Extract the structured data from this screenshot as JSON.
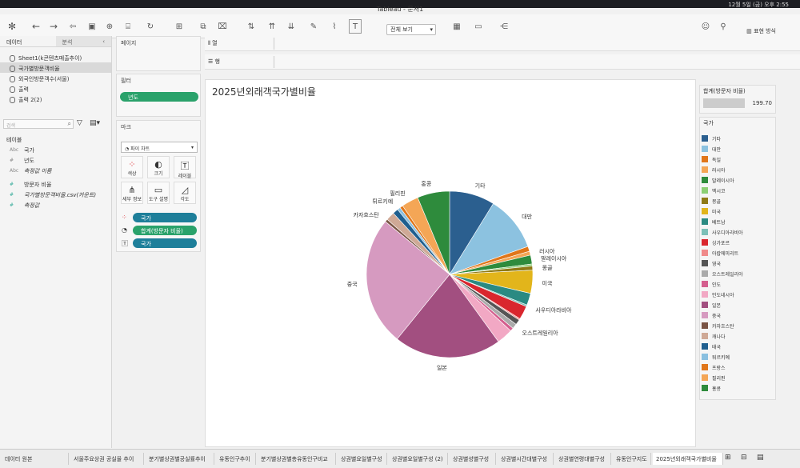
{
  "menubar": {
    "datetime": "12월 5일 (금) 오후 2:55"
  },
  "window": {
    "title": "Tableau - 문서1"
  },
  "toolbar": {
    "view_mode": "전체 보기",
    "show_me": "표현 방식"
  },
  "data_pane": {
    "tabs": [
      "데이터",
      "분석"
    ],
    "datasources": [
      "Sheet1(k콘텐츠매출추이)",
      "국가별방문객비율",
      "외국인방문객수(서울)",
      "출력",
      "출력 2(2)"
    ],
    "search_placeholder": "검색",
    "tables_header": "테이블",
    "fields": [
      {
        "type": "Abc",
        "name": "국가",
        "italic": false
      },
      {
        "type": "#",
        "name": "년도",
        "italic": false
      },
      {
        "type": "Abc",
        "name": "측정값 이름",
        "italic": true
      },
      {
        "type": "#",
        "name": "방문자 비율",
        "italic": false
      },
      {
        "type": "#",
        "name": "국가별방문객비율.csv(카운트)",
        "italic": true
      },
      {
        "type": "#",
        "name": "측정값",
        "italic": true
      }
    ]
  },
  "pages": {
    "title": "페이지"
  },
  "filters": {
    "title": "필터",
    "pills": [
      "년도"
    ]
  },
  "marks": {
    "title": "마크",
    "type": "파이 차트",
    "buttons": [
      {
        "label": "색상",
        "icon": "color-icon"
      },
      {
        "label": "크기",
        "icon": "size-icon"
      },
      {
        "label": "레이블",
        "icon": "label-icon"
      },
      {
        "label": "세부 정보",
        "icon": "detail-icon"
      },
      {
        "label": "도구 설명",
        "icon": "tooltip-icon"
      },
      {
        "label": "각도",
        "icon": "angle-icon"
      }
    ],
    "encodings": [
      {
        "label": "국가",
        "color": "#1e7f9a",
        "icon": "color-encoding-icon"
      },
      {
        "label": "합계(방문자 비율)",
        "color": "#2aa26b",
        "icon": "angle-encoding-icon"
      },
      {
        "label": "국가",
        "color": "#1e7f9a",
        "icon": "label-encoding-icon"
      }
    ]
  },
  "shelves": {
    "columns": "열",
    "rows": "행"
  },
  "sum_card": {
    "title": "합계(방문자 비율)",
    "value": "199.70"
  },
  "legend": {
    "title": "국가",
    "items": [
      {
        "label": "기타",
        "color": "#2b5f8f"
      },
      {
        "label": "대만",
        "color": "#8cc2e0"
      },
      {
        "label": "독일",
        "color": "#e0761a"
      },
      {
        "label": "러시아",
        "color": "#f4a656"
      },
      {
        "label": "말레이시아",
        "color": "#2e8b3c"
      },
      {
        "label": "멕시코",
        "color": "#8ccf74"
      },
      {
        "label": "몽골",
        "color": "#8f7a16"
      },
      {
        "label": "미국",
        "color": "#e2b51b"
      },
      {
        "label": "베트남",
        "color": "#2a8a82"
      },
      {
        "label": "사우디아라비아",
        "color": "#7cc0b8"
      },
      {
        "label": "싱가포르",
        "color": "#d9262e"
      },
      {
        "label": "아랍에미리트",
        "color": "#f08a8a"
      },
      {
        "label": "영국",
        "color": "#555555"
      },
      {
        "label": "오스트레일리아",
        "color": "#aaaaaa"
      },
      {
        "label": "인도",
        "color": "#d45e8e"
      },
      {
        "label": "인도네시아",
        "color": "#f2a8c4"
      },
      {
        "label": "일본",
        "color": "#a24f80"
      },
      {
        "label": "중국",
        "color": "#d69ac0"
      },
      {
        "label": "카자흐스탄",
        "color": "#7a5444"
      },
      {
        "label": "캐나다",
        "color": "#cfa996"
      },
      {
        "label": "태국",
        "color": "#1f5f8f"
      },
      {
        "label": "튀르키예",
        "color": "#8ac0e0"
      },
      {
        "label": "프랑스",
        "color": "#e0761a"
      },
      {
        "label": "필리핀",
        "color": "#f4a656"
      },
      {
        "label": "홍콩",
        "color": "#2e8b3c"
      }
    ]
  },
  "bottom_tabs": [
    "데이터 원본",
    "서울주요상권 공실율 추이",
    "분기별상권별공실률추이",
    "유동인구추이",
    "분기별상권별총유동인구비교",
    "상권별요일별구성",
    "상권별요일별구성 (2)",
    "상권별성별구성",
    "상권별시간대별구성",
    "상권별연령대별구성",
    "유동인구지도",
    "2025년외래객국가별비율"
  ],
  "chart_data": {
    "type": "pie",
    "title": "2025년외래객국가별비율",
    "total": 199.7,
    "slices": [
      {
        "label": "기타",
        "value": 16.3,
        "color": "#2b5f8f",
        "show_label": true
      },
      {
        "label": "대만",
        "value": 19.9,
        "color": "#8cc2e0",
        "show_label": true
      },
      {
        "label": "독일",
        "value": 1.8,
        "color": "#e0761a",
        "show_label": false
      },
      {
        "label": "러시아",
        "value": 1.4,
        "color": "#f4a656",
        "show_label": true
      },
      {
        "label": "말레이시아",
        "value": 3.2,
        "color": "#2e8b3c",
        "show_label": true
      },
      {
        "label": "멕시코",
        "value": 0.7,
        "color": "#8ccf74",
        "show_label": false
      },
      {
        "label": "몽골",
        "value": 1.5,
        "color": "#8f7a16",
        "show_label": true
      },
      {
        "label": "미국",
        "value": 8.3,
        "color": "#e2b51b",
        "show_label": true
      },
      {
        "label": "베트남",
        "value": 4.3,
        "color": "#2a8a82",
        "show_label": false
      },
      {
        "label": "사우디아라비아",
        "value": 0.6,
        "color": "#7cc0b8",
        "show_label": true
      },
      {
        "label": "싱가포르",
        "value": 4.9,
        "color": "#d9262e",
        "show_label": false
      },
      {
        "label": "아랍에미리트",
        "value": 0.5,
        "color": "#f08a8a",
        "show_label": false
      },
      {
        "label": "영국",
        "value": 1.9,
        "color": "#555555",
        "show_label": false
      },
      {
        "label": "오스트레일리아",
        "value": 1.8,
        "color": "#aaaaaa",
        "show_label": true
      },
      {
        "label": "인도",
        "value": 1.2,
        "color": "#d45e8e",
        "show_label": false
      },
      {
        "label": "인도네시아",
        "value": 5.8,
        "color": "#f2a8c4",
        "show_label": false
      },
      {
        "label": "일본",
        "value": 38.6,
        "color": "#a24f80",
        "show_label": true
      },
      {
        "label": "중국",
        "value": 46.5,
        "color": "#d69ac0",
        "show_label": true
      },
      {
        "label": "카자흐스탄",
        "value": 1.0,
        "color": "#7a5444",
        "show_label": true
      },
      {
        "label": "캐나다",
        "value": 3.1,
        "color": "#cfa996",
        "show_label": false
      },
      {
        "label": "태국",
        "value": 2.0,
        "color": "#1f5f8f",
        "show_label": false
      },
      {
        "label": "튀르키예",
        "value": 1.1,
        "color": "#8ac0e0",
        "show_label": true
      },
      {
        "label": "프랑스",
        "value": 1.1,
        "color": "#e0761a",
        "show_label": false
      },
      {
        "label": "필리핀",
        "value": 6.1,
        "color": "#f4a656",
        "show_label": true
      },
      {
        "label": "홍콩",
        "value": 11.6,
        "color": "#2e8b3c",
        "show_label": true
      }
    ]
  }
}
